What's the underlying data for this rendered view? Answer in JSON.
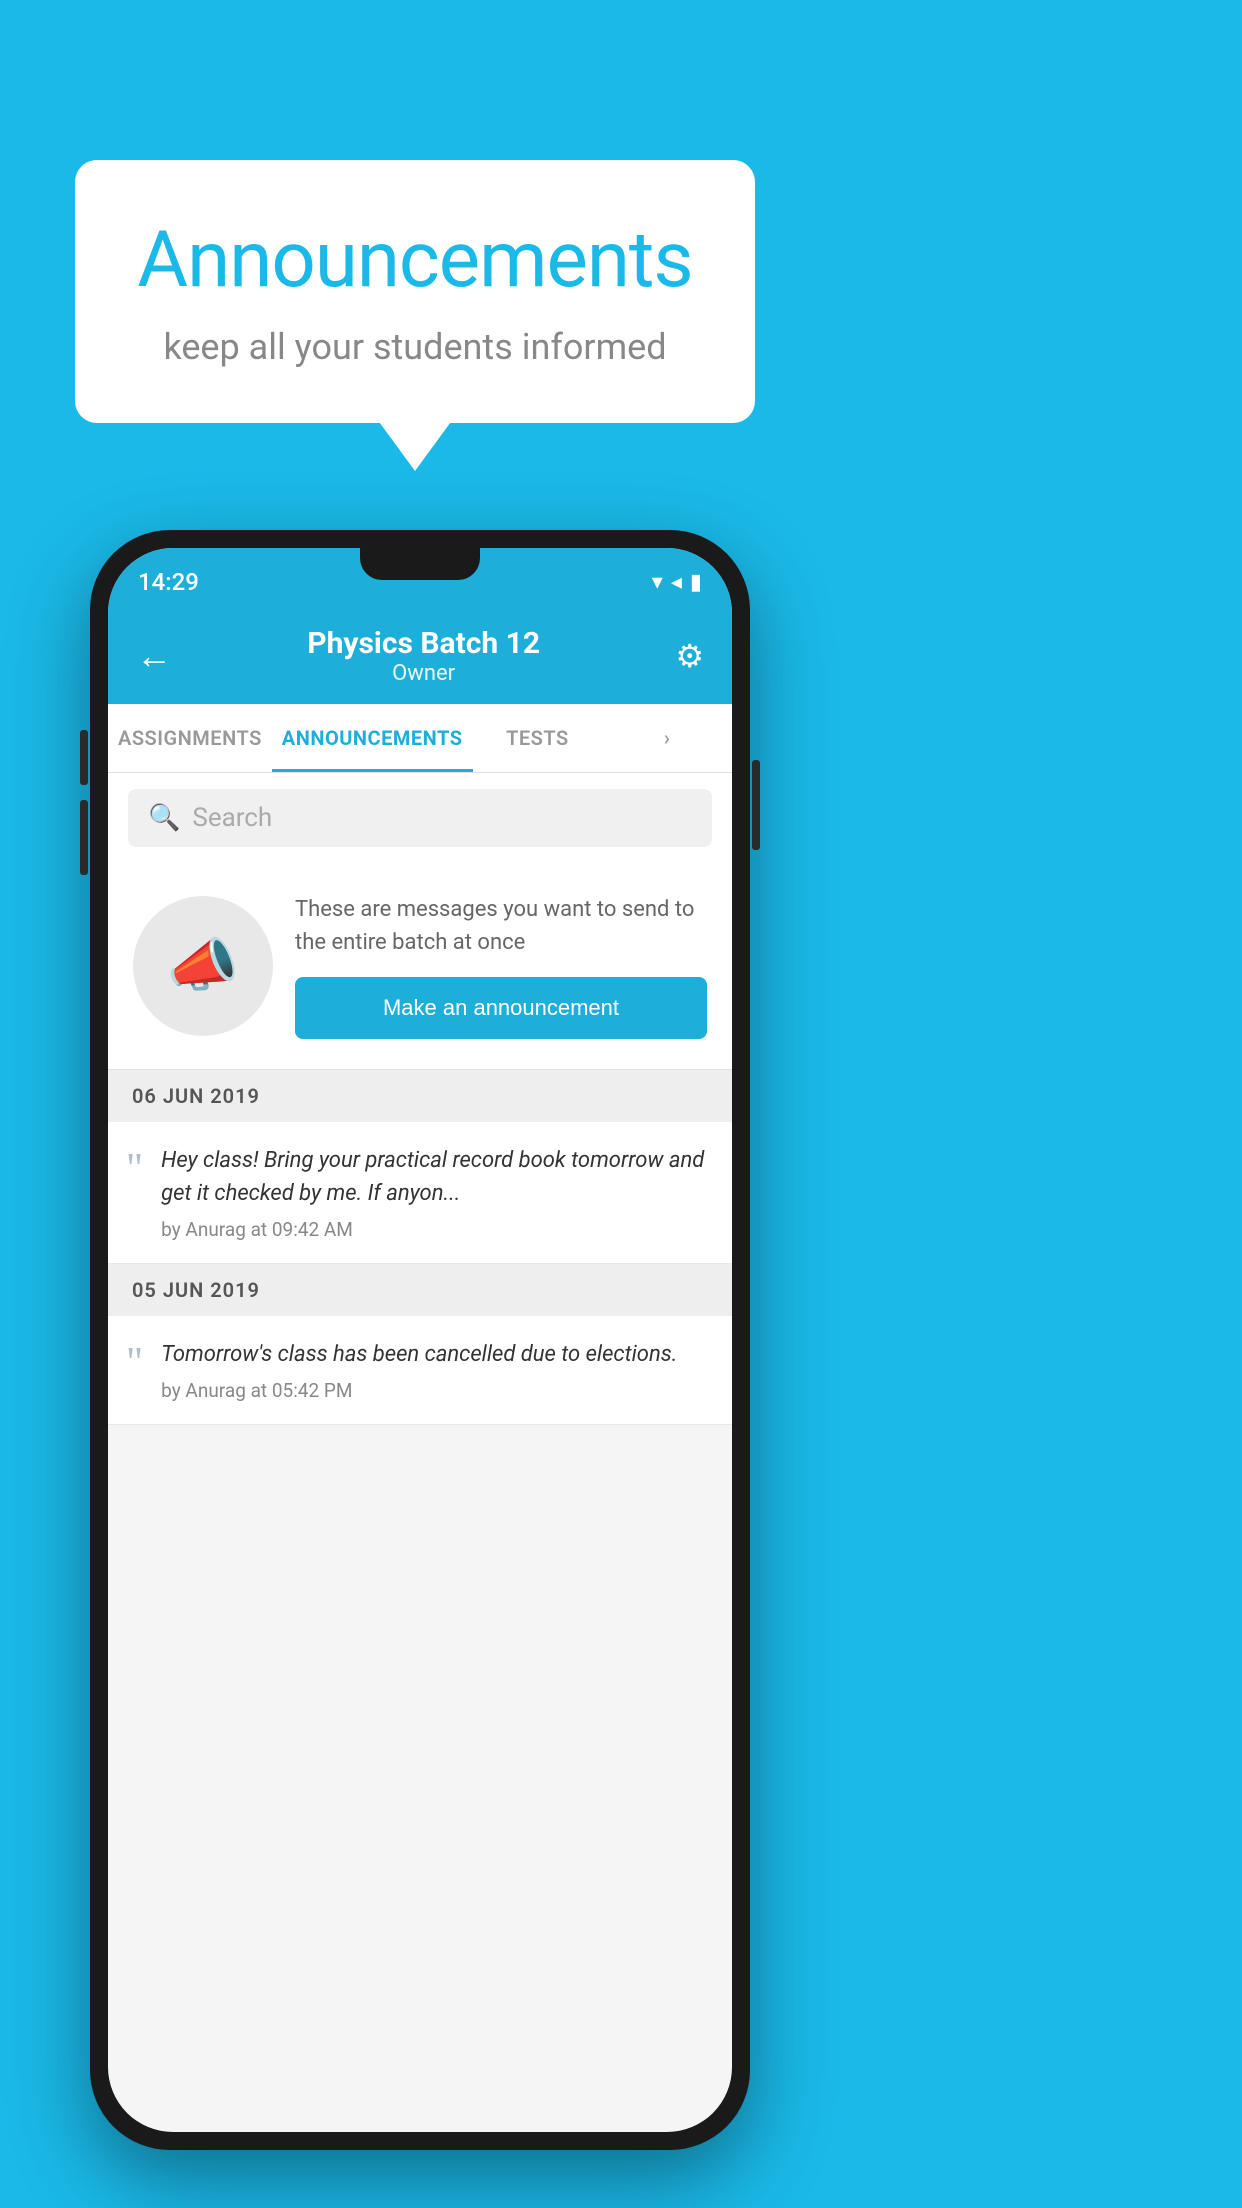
{
  "background_color": "#1ab9e8",
  "speech_bubble": {
    "title": "Announcements",
    "subtitle": "keep all your students informed"
  },
  "phone": {
    "status_bar": {
      "time": "14:29",
      "icons": "▾◂▮"
    },
    "header": {
      "back_label": "←",
      "title": "Physics Batch 12",
      "subtitle": "Owner",
      "gear_label": "⚙"
    },
    "tabs": [
      {
        "label": "ASSIGNMENTS",
        "active": false
      },
      {
        "label": "ANNOUNCEMENTS",
        "active": true
      },
      {
        "label": "TESTS",
        "active": false
      },
      {
        "label": "›",
        "active": false
      }
    ],
    "search": {
      "placeholder": "Search"
    },
    "promo_card": {
      "description": "These are messages you want to send to the entire batch at once",
      "button_label": "Make an announcement"
    },
    "announcements": [
      {
        "date": "06  JUN  2019",
        "message": "Hey class! Bring your practical record book tomorrow and get it checked by me. If anyon...",
        "meta": "by Anurag at 09:42 AM"
      },
      {
        "date": "05  JUN  2019",
        "message": "Tomorrow's class has been cancelled due to elections.",
        "meta": "by Anurag at 05:42 PM"
      }
    ]
  }
}
